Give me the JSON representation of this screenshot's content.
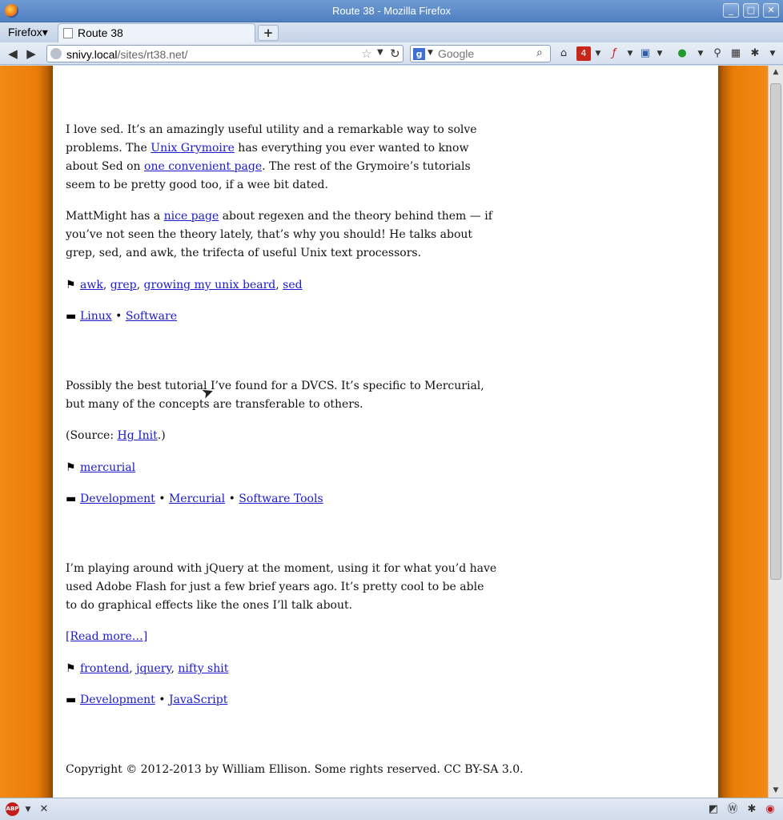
{
  "window": {
    "title": "Route 38 - Mozilla Firefox",
    "controls": {
      "minimize": "_",
      "maximize": "□",
      "close": "✕"
    }
  },
  "tabbar": {
    "firefox_menu": "Firefox",
    "tabs": [
      {
        "label": "Route 38"
      }
    ],
    "new_tab": "+"
  },
  "navbar": {
    "url_host": "snivy.local",
    "url_path": "/sites/rt38.net/",
    "search_placeholder": "Google",
    "search_engine": "g",
    "notification_count": "4"
  },
  "posts": [
    {
      "paragraphs": [
        {
          "parts": [
            "I love sed.  It’s an amazingly useful utility and a remarkable way to solve problems.  The ",
            {
              "link": "Unix Grymoire"
            },
            " has everything you ever wanted to know about Sed on ",
            {
              "link": "one convenient page"
            },
            ".  The rest of the Grymoire’s tutorials seem to be pretty good too, if a wee bit dated."
          ]
        },
        {
          "parts": [
            "MattMight has a ",
            {
              "link": "nice page"
            },
            " about regexen and the theory behind them — if you’ve not seen the theory lately, that’s why you should!  He talks about grep, sed, and awk, the trifecta of useful Unix text processors."
          ]
        }
      ],
      "tags": [
        "awk",
        "grep",
        "growing my unix beard",
        "sed"
      ],
      "categories": [
        "Linux",
        "Software"
      ]
    },
    {
      "paragraphs": [
        {
          "parts": [
            "Possibly the best tutorial I’ve found for a DVCS.  It’s specific to Mercurial, but many of the concepts are transferable to others."
          ]
        },
        {
          "parts": [
            "(Source: ",
            {
              "link": "Hg Init"
            },
            ".)"
          ]
        }
      ],
      "tags": [
        "mercurial"
      ],
      "categories": [
        "Development",
        "Mercurial",
        "Software Tools"
      ]
    },
    {
      "paragraphs": [
        {
          "parts": [
            "I’m playing around with jQuery at the moment, using it for what you’d have used Adobe Flash for just a few brief years ago.  It’s pretty cool to be able to do graphical effects like the ones I’ll talk about."
          ]
        }
      ],
      "read_more": "[Read more…]",
      "tags": [
        "frontend",
        "jquery",
        "nifty shit"
      ],
      "categories": [
        "Development",
        "JavaScript"
      ]
    }
  ],
  "footer": {
    "copyright": "Copyright © 2012-2013 by William Ellison. Some rights reserved. CC BY-SA 3.0."
  },
  "colors": {
    "side_orange": "#ea7d08",
    "link": "#1a1acc"
  }
}
